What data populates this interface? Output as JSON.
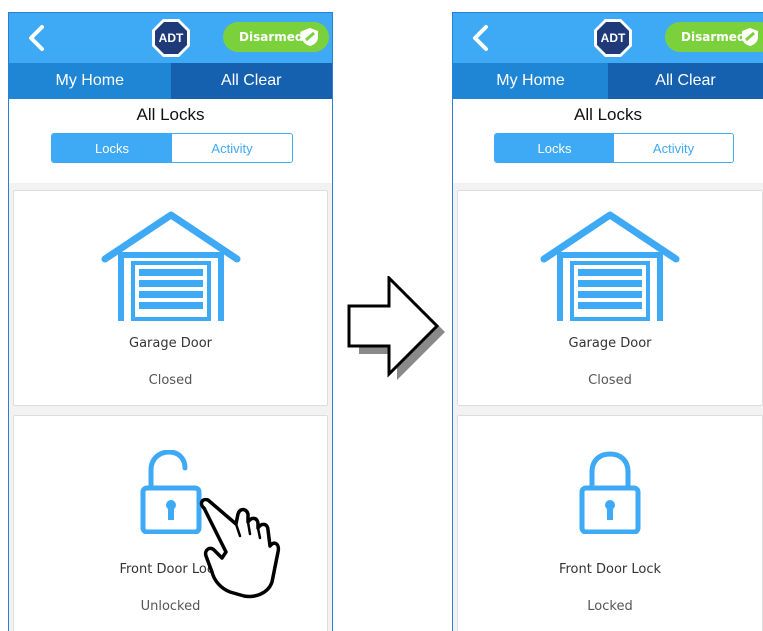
{
  "before": {
    "header": {
      "brand": "ADT",
      "status": "Disarmed"
    },
    "nav": {
      "home": "My Home",
      "status": "All Clear"
    },
    "page_title": "All Locks",
    "segments": {
      "active": "Locks",
      "inactive": "Activity"
    },
    "devices": [
      {
        "name": "Garage Door",
        "state": "Closed",
        "icon": "garage-icon"
      },
      {
        "name": "Front Door Lock",
        "state": "Unlocked",
        "icon": "unlocked-padlock-icon"
      }
    ]
  },
  "after": {
    "header": {
      "brand": "ADT",
      "status": "Disarmed"
    },
    "nav": {
      "home": "My Home",
      "status": "All Clear"
    },
    "page_title": "All Locks",
    "segments": {
      "active": "Locks",
      "inactive": "Activity"
    },
    "devices": [
      {
        "name": "Garage Door",
        "state": "Closed",
        "icon": "garage-icon"
      },
      {
        "name": "Front Door Lock",
        "state": "Locked",
        "icon": "locked-padlock-icon"
      }
    ]
  },
  "colors": {
    "header_blue": "#3ea9f5",
    "nav_home": "#1f86d6",
    "nav_status": "#1561b0",
    "status_green": "#7bd13c",
    "adt_navy": "#1f3a78",
    "icon_blue": "#3ea9f5"
  }
}
